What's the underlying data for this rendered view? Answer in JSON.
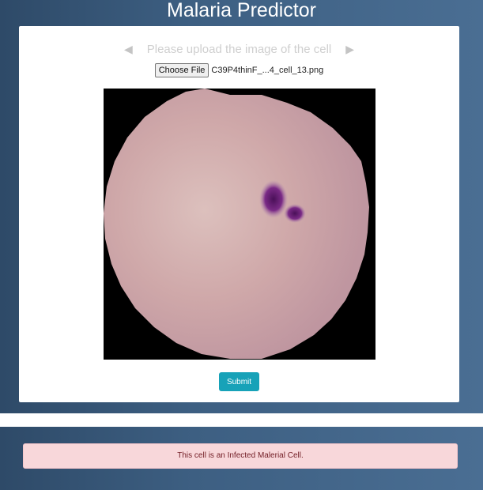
{
  "header": {
    "title": "Malaria Predictor"
  },
  "upload": {
    "prompt": "Please upload the image of the cell",
    "choose_file_label": "Choose File",
    "file_name": "C39P4thinF_...4_cell_13.png"
  },
  "preview": {
    "icon": "cell-image"
  },
  "actions": {
    "submit_label": "Submit"
  },
  "result": {
    "message": "This cell is an Infected Malerial Cell."
  },
  "colors": {
    "accent": "#17a2b8",
    "alert_bg": "#f8d7da",
    "alert_text": "#721c24"
  }
}
